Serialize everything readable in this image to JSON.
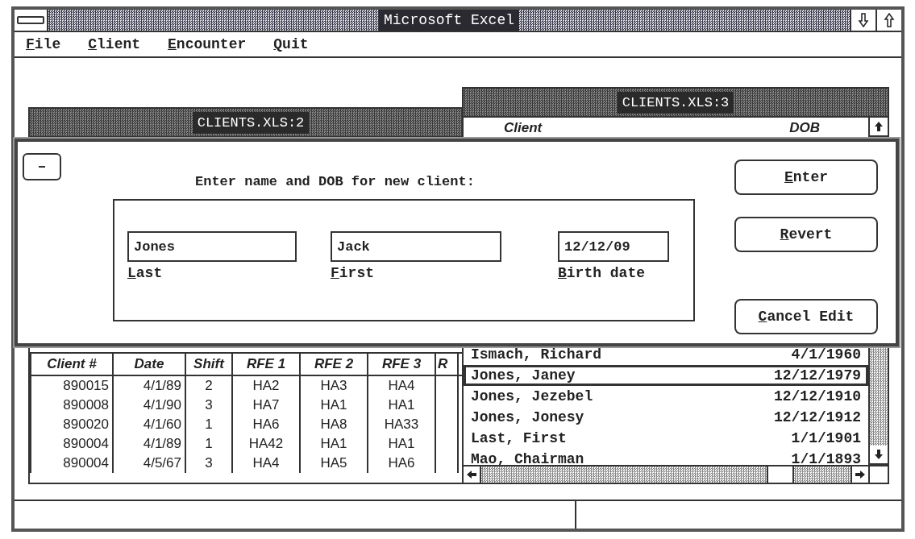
{
  "window": {
    "title": "Microsoft Excel"
  },
  "menu": [
    "File",
    "Client",
    "Encounter",
    "Quit"
  ],
  "sheet_left": {
    "title": "CLIENTS.XLS:2",
    "columns": [
      "Client #",
      "Date",
      "Shift",
      "RFE 1",
      "RFE 2",
      "RFE 3",
      "R"
    ],
    "rows": [
      [
        "890015",
        "4/1/89",
        "2",
        "HA2",
        "HA3",
        "HA4"
      ],
      [
        "890008",
        "4/1/90",
        "3",
        "HA7",
        "HA1",
        "HA1"
      ],
      [
        "890020",
        "4/1/60",
        "1",
        "HA6",
        "HA8",
        "HA33"
      ],
      [
        "890004",
        "4/1/89",
        "1",
        "HA42",
        "HA1",
        "HA1"
      ],
      [
        "890004",
        "4/5/67",
        "3",
        "HA4",
        "HA5",
        "HA6"
      ]
    ]
  },
  "sheet_right": {
    "title": "CLIENTS.XLS:3",
    "columns": [
      "Client",
      "DOB"
    ],
    "rows": [
      {
        "name": "Ismach, Richard",
        "dob": "4/1/1960",
        "selected": false
      },
      {
        "name": "Jones, Janey",
        "dob": "12/12/1979",
        "selected": true
      },
      {
        "name": "Jones, Jezebel",
        "dob": "12/12/1910",
        "selected": false
      },
      {
        "name": "Jones, Jonesy",
        "dob": "12/12/1912",
        "selected": false
      },
      {
        "name": "Last, First",
        "dob": "1/1/1901",
        "selected": false
      },
      {
        "name": "Mao, Chairman",
        "dob": "1/1/1893",
        "selected": false
      }
    ]
  },
  "dialog": {
    "prompt": "Enter name and DOB for new client:",
    "fields": [
      {
        "label": "Last",
        "value": "Jones"
      },
      {
        "label": "First",
        "value": "Jack"
      },
      {
        "label": "Birth date",
        "value": "12/12/09"
      }
    ],
    "buttons": [
      "Enter",
      "Revert",
      "Cancel Edit"
    ]
  }
}
